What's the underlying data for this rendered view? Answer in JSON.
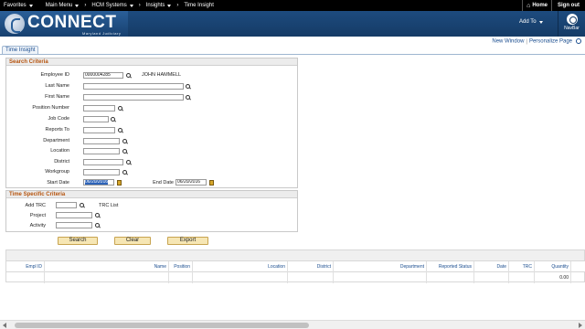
{
  "topnav": {
    "items": [
      "Favorites",
      "Main Menu",
      "HCM Systems",
      "Insights"
    ],
    "current": "Time Insight",
    "home": "Home",
    "signout": "Sign out"
  },
  "header": {
    "logo_text": "CONNECT",
    "logo_sub": "Maryland Judiciary",
    "add_to": "Add To",
    "navbar": "NavBar"
  },
  "links": {
    "new_window": "New Window",
    "personalize": "Personalize Page"
  },
  "tab": "Time Insight",
  "search_criteria": {
    "title": "Search Criteria",
    "employee_id_label": "Employee ID",
    "employee_id_value": "0000004285",
    "employee_name": "JOHN HAMMELL",
    "last_name_label": "Last Name",
    "first_name_label": "First Name",
    "position_number_label": "Position Number",
    "job_code_label": "Job Code",
    "reports_to_label": "Reports To",
    "department_label": "Department",
    "location_label": "Location",
    "district_label": "District",
    "workgroup_label": "Workgroup",
    "start_date_label": "Start Date",
    "start_date_value": "06/20/2016",
    "end_date_label": "End Date",
    "end_date_value": "06/20/2016"
  },
  "time_specific": {
    "title": "Time Specific Criteria",
    "add_trc_label": "Add TRC",
    "trc_list": "TRC List",
    "project_label": "Project",
    "activity_label": "Activity"
  },
  "buttons": {
    "search": "Search",
    "clear": "Clear",
    "export": "Export"
  },
  "grid": {
    "columns": [
      "Empl ID",
      "Name",
      "Position",
      "Location",
      "District",
      "Department",
      "Reported Status",
      "Date",
      "TRC",
      "Quantity"
    ],
    "quantity_value": "0.00"
  }
}
